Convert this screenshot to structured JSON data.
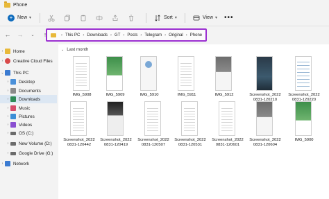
{
  "window": {
    "title": "Phone"
  },
  "toolbar": {
    "new_label": "New",
    "sort_label": "Sort",
    "view_label": "View",
    "more_label": "•••"
  },
  "address": {
    "crumbs": [
      "This PC",
      "Downloads",
      "GT",
      "Posts",
      "Telegram",
      "Original",
      "Phone"
    ],
    "accent": "#9b2fd1"
  },
  "sidebar": {
    "items": [
      {
        "label": "Home",
        "icon": "home-icon",
        "color": "#e8b93a"
      },
      {
        "label": "Creative Cloud Files",
        "icon": "creative-cloud-icon",
        "color": "#d94a4a"
      },
      {
        "label": "This PC",
        "icon": "pc-icon",
        "color": "#3b7bd1"
      },
      {
        "label": "Desktop",
        "icon": "desktop-icon",
        "color": "#4a90d9"
      },
      {
        "label": "Documents",
        "icon": "documents-icon",
        "color": "#8a8a8a"
      },
      {
        "label": "Downloads",
        "icon": "downloads-icon",
        "color": "#2e8b57"
      },
      {
        "label": "Music",
        "icon": "music-icon",
        "color": "#d64b6a"
      },
      {
        "label": "Pictures",
        "icon": "pictures-icon",
        "color": "#3c8ed6"
      },
      {
        "label": "Videos",
        "icon": "videos-icon",
        "color": "#8a4fd1"
      },
      {
        "label": "OS (C:)",
        "icon": "drive-icon",
        "color": "#6b6b6b"
      },
      {
        "label": "New Volume (D:)",
        "icon": "drive-icon",
        "color": "#6b6b6b"
      },
      {
        "label": "Google Drive (G:)",
        "icon": "drive-icon",
        "color": "#6b6b6b"
      },
      {
        "label": "Network",
        "icon": "network-icon",
        "color": "#3b7bd1"
      }
    ]
  },
  "content": {
    "group_label": "Last month",
    "files": [
      {
        "name": "IMG_5908",
        "style": "t-lines"
      },
      {
        "name": "IMG_5909",
        "style": "t-green"
      },
      {
        "name": "IMG_5910",
        "style": "t-chat"
      },
      {
        "name": "IMG_5911",
        "style": "t-lines"
      },
      {
        "name": "IMG_5912",
        "style": "t-gray"
      },
      {
        "name": "Screenshot_2022 0831-120210",
        "style": "t-dark"
      },
      {
        "name": "Screenshot_2022 0831-120220",
        "style": "t-list"
      },
      {
        "name": "Screenshot_2022 0831-120442",
        "style": "t-lines"
      },
      {
        "name": "Screenshot_2022 0831-120419",
        "style": "t-black"
      },
      {
        "name": "Screenshot_2022 0831-120507",
        "style": "t-lines"
      },
      {
        "name": "Screenshot_2022 0831-120531",
        "style": "t-lines"
      },
      {
        "name": "Screenshot_2022 0831-120601",
        "style": "t-lines"
      },
      {
        "name": "Screenshot_2022 0831-120604",
        "style": "t-gray"
      },
      {
        "name": "IMG_5900",
        "style": "t-green"
      }
    ]
  }
}
